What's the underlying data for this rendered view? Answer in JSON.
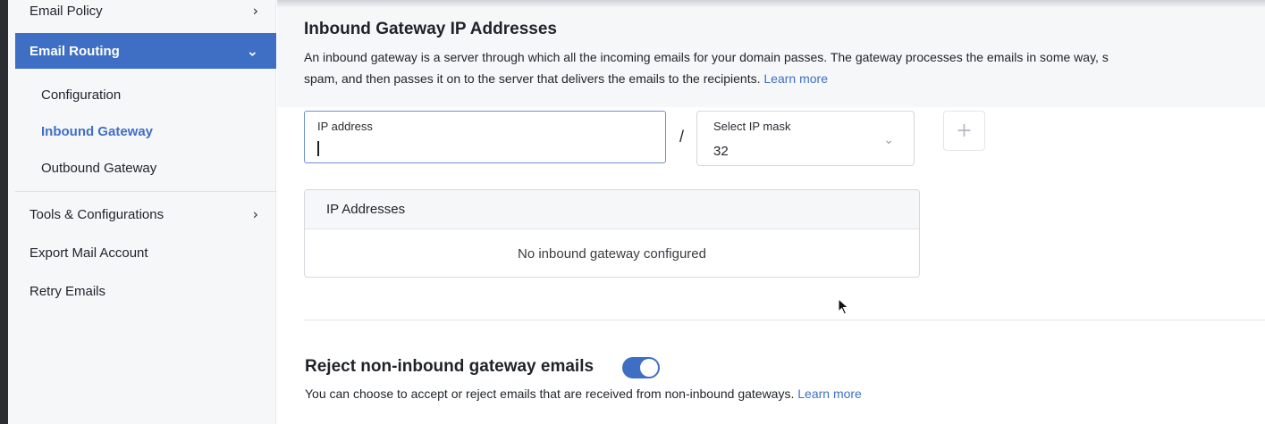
{
  "sidebar": {
    "items_top": [
      {
        "label": "Email Policy",
        "chevron": "›"
      },
      {
        "label": "Email Routing",
        "chevron": "⌄"
      }
    ],
    "sub_items": [
      {
        "label": "Configuration"
      },
      {
        "label": "Inbound Gateway"
      },
      {
        "label": "Outbound Gateway"
      }
    ],
    "items_bottom": [
      {
        "label": "Tools & Configurations",
        "chevron": "›"
      },
      {
        "label": "Export Mail Account"
      },
      {
        "label": "Retry Emails"
      }
    ]
  },
  "main": {
    "title": "Inbound Gateway IP Addresses",
    "description_line1": "An inbound gateway is a server through which all the incoming emails for your domain passes. The gateway processes the emails in some way, s",
    "description_line2": "spam, and then passes it on to the server that delivers the emails to the recipients.",
    "learn_more": "Learn more",
    "ip_field": {
      "label": "IP address",
      "value": ""
    },
    "separator": "/",
    "mask_select": {
      "label": "Select IP mask",
      "value": "32",
      "chevron": "⌄"
    },
    "add_button": "+",
    "table": {
      "header": "IP Addresses",
      "empty_text": "No inbound gateway configured"
    },
    "reject": {
      "title": "Reject non-inbound gateway emails",
      "enabled": true,
      "description": "You can choose to accept or reject emails that are received from non-inbound gateways.",
      "learn_more": "Learn more"
    }
  },
  "colors": {
    "accent": "#3f6fc4",
    "sidebar_bg": "#f6f7f9",
    "text": "#1f2329"
  }
}
